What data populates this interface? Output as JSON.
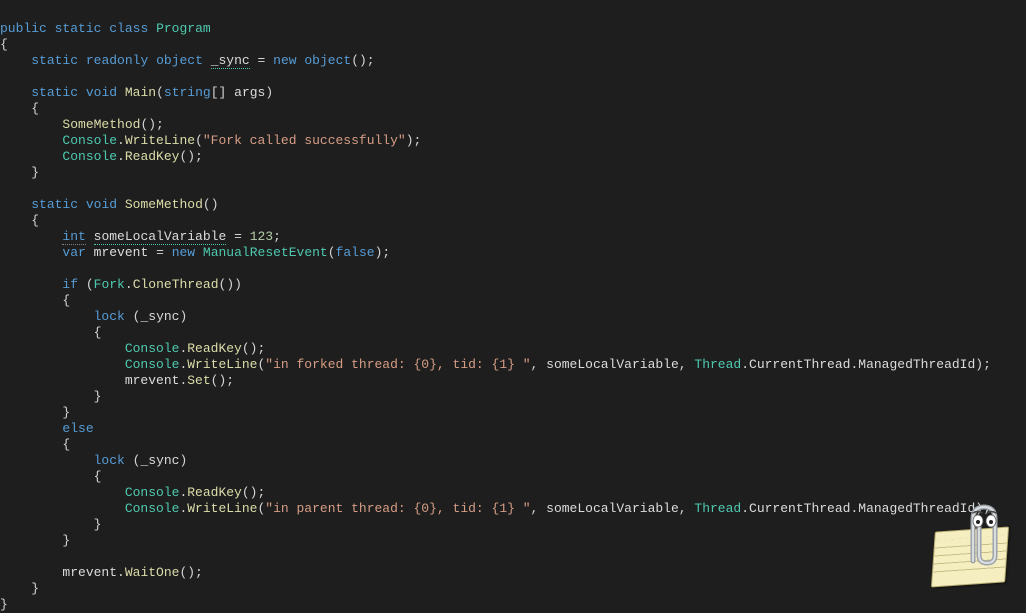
{
  "code": {
    "l1_public": "public",
    "l1_static": "static",
    "l1_class": "class",
    "l1_Program": "Program",
    "l3_static": "static",
    "l3_readonly": "readonly",
    "l3_object": "object",
    "l3_sync": "_sync",
    "l3_new": "new",
    "l3_object2": "object",
    "l5_static": "static",
    "l5_void": "void",
    "l5_Main": "Main",
    "l5_string": "string",
    "l5_args": "args",
    "l7_SomeMethod": "SomeMethod",
    "l8_Console": "Console",
    "l8_WriteLine": "WriteLine",
    "l8_str": "\"Fork called successfully\"",
    "l9_Console": "Console",
    "l9_ReadKey": "ReadKey",
    "l12_static": "static",
    "l12_void": "void",
    "l12_SomeMethod": "SomeMethod",
    "l14_int": "int",
    "l14_var": "someLocalVariable",
    "l14_num": "123",
    "l15_var": "var",
    "l15_mrevent": "mrevent",
    "l15_new": "new",
    "l15_MRE": "ManualResetEvent",
    "l15_false": "false",
    "l17_if": "if",
    "l17_Fork": "Fork",
    "l17_CloneThread": "CloneThread",
    "l19_lock": "lock",
    "l19_sync": "_sync",
    "l21_Console": "Console",
    "l21_ReadKey": "ReadKey",
    "l22_Console": "Console",
    "l22_WriteLine": "WriteLine",
    "l22_str": "\"in forked thread: {0}, tid: {1} \"",
    "l22_slv": "someLocalVariable",
    "l22_Thread": "Thread",
    "l22_CT": "CurrentThread",
    "l22_MTI": "ManagedThreadId",
    "l23_mrevent": "mrevent",
    "l23_Set": "Set",
    "l26_else": "else",
    "l28_lock": "lock",
    "l28_sync": "_sync",
    "l30_Console": "Console",
    "l30_ReadKey": "ReadKey",
    "l31_Console": "Console",
    "l31_WriteLine": "WriteLine",
    "l31_str": "\"in parent thread: {0}, tid: {1} \"",
    "l31_slv": "someLocalVariable",
    "l31_Thread": "Thread",
    "l31_CT": "CurrentThread",
    "l31_MTI": "ManagedThreadId",
    "l35_mrevent": "mrevent",
    "l35_WaitOne": "WaitOne"
  },
  "assistant": {
    "name": "clippy-assistant"
  }
}
